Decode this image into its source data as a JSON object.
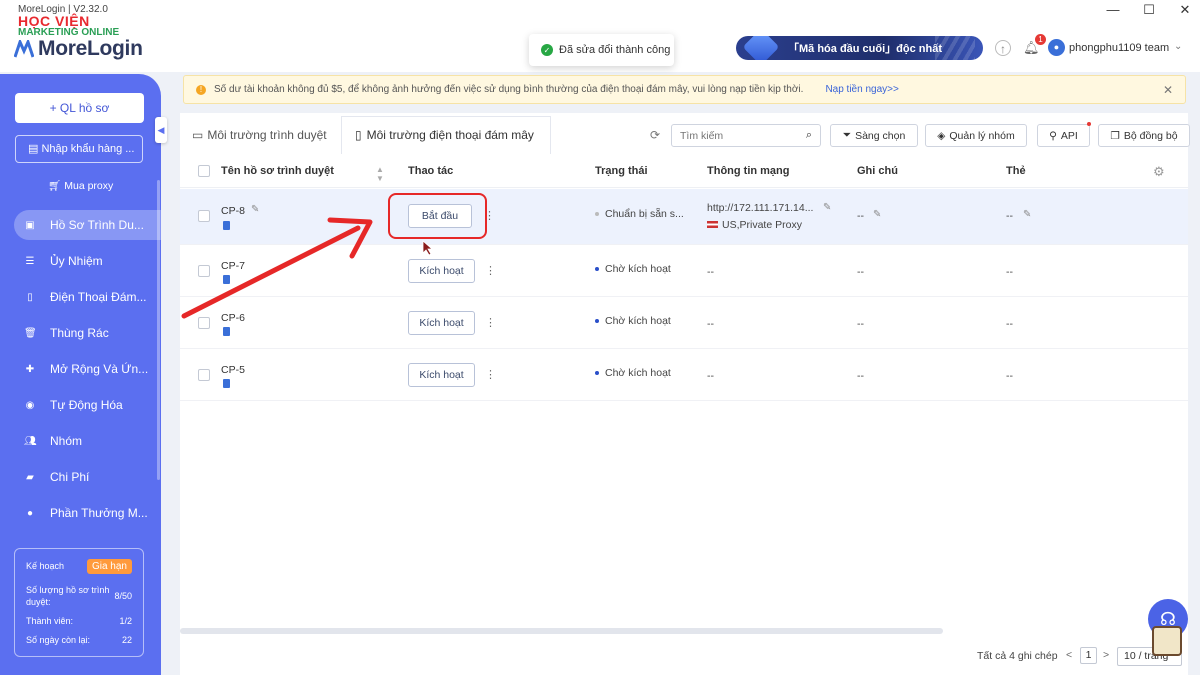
{
  "window": {
    "title": "MoreLogin | V2.32.0",
    "minimize": "—",
    "maximize": "☐",
    "close": "✕"
  },
  "watermark": {
    "line1": "HỌC VIỆN",
    "line2": "MARKETING ONLINE"
  },
  "header": {
    "logo": "MoreLogin",
    "toast": "Đã sửa đổi thành công",
    "promo": "「Mã hóa đầu cuối」độc nhất",
    "bell_count": "1",
    "user": "phongphu1109 team"
  },
  "sidebar": {
    "new_profile": "+ QL hồ sơ",
    "import": "Nhập khẩu hàng ...",
    "buy_proxy": "Mua proxy",
    "items": [
      {
        "label": "Hồ Sơ Trình Du...",
        "icon": "browser-icon"
      },
      {
        "label": "Ủy Nhiệm",
        "icon": "list-icon"
      },
      {
        "label": "Điện Thoại Đám...",
        "icon": "phone-icon"
      },
      {
        "label": "Thùng Rác",
        "icon": "trash-icon"
      },
      {
        "label": "Mở Rộng Và Ứn...",
        "icon": "puzzle-icon"
      },
      {
        "label": "Tự Động Hóa",
        "icon": "robot-icon"
      },
      {
        "label": "Nhóm",
        "icon": "group-icon"
      },
      {
        "label": "Chi Phí",
        "icon": "wallet-icon"
      },
      {
        "label": "Phần Thưởng M...",
        "icon": "reward-icon"
      }
    ],
    "plan": {
      "title": "Kế hoạch",
      "renew": "Gia hạn",
      "profiles_label_1": "Số lượng hồ sơ trình",
      "profiles_label_2": "duyệt:",
      "profiles_value": "8/50",
      "members_label": "Thành viên:",
      "members_value": "1/2",
      "days_label": "Số ngày còn lại:",
      "days_value": "22"
    }
  },
  "notice": {
    "text": "Số dư tài khoản không đủ $5, để không ảnh hưởng đến việc sử dụng bình thường của điện thoại đám mây, vui lòng nạp tiền kịp thời.",
    "link": "Nạp tiền ngay>>"
  },
  "tabs": [
    {
      "label": "Môi trường trình duyệt"
    },
    {
      "label": "Môi trường điện thoại đám mây"
    }
  ],
  "toolbar": {
    "search_placeholder": "Tìm kiếm",
    "filter": "Sàng chọn",
    "groups": "Quản lý nhóm",
    "api": "API",
    "sync": "Bộ đồng bộ"
  },
  "table": {
    "columns": [
      "Tên hồ sơ trình duyệt",
      "Thao tác",
      "Trạng thái",
      "Thông tin mạng",
      "Ghi chú",
      "Thẻ"
    ],
    "rows": [
      {
        "name": "CP-8",
        "action": "Bắt đầu",
        "status": "Chuẩn bị sẵn s...",
        "network": "http://172.111.171.14...",
        "proxy": "US,Private Proxy",
        "note": "--",
        "tag": "--"
      },
      {
        "name": "CP-7",
        "action": "Kích hoạt",
        "status": "Chờ kích hoạt",
        "network": "--",
        "note": "--",
        "tag": "--"
      },
      {
        "name": "CP-6",
        "action": "Kích hoạt",
        "status": "Chờ kích hoạt",
        "network": "--",
        "note": "--",
        "tag": "--"
      },
      {
        "name": "CP-5",
        "action": "Kích hoạt",
        "status": "Chờ kích hoạt",
        "network": "--",
        "note": "--",
        "tag": "--"
      }
    ]
  },
  "footer": {
    "total": "Tất cả 4 ghi chép",
    "prev": "<",
    "page": "1",
    "next": ">",
    "page_size": "10 / trang"
  }
}
